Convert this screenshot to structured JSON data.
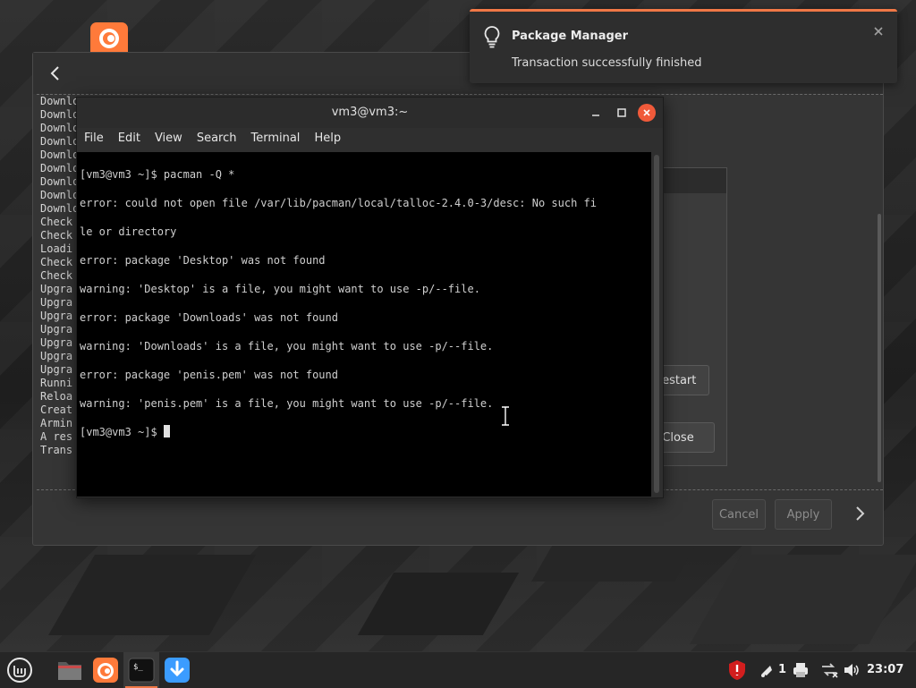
{
  "background_app": {
    "log_lines": [
      "Downlo",
      "Downlo",
      "Downlo",
      "Downlo",
      "Downlo",
      "Downlo",
      "Downlo",
      "Downlo",
      "Downlo",
      "Check",
      "Check",
      "Loadi",
      "Check",
      "Check",
      "Upgra",
      "Upgra",
      "Upgra",
      "Upgra",
      "Upgra",
      "Upgra",
      "Upgra",
      "Runni",
      "Reloa",
      "Creat",
      "Armin",
      "A res",
      "Trans"
    ],
    "restart_label": "Restart",
    "close_label": "Close",
    "cancel_label": "Cancel",
    "apply_label": "Apply"
  },
  "terminal": {
    "title": "vm3@vm3:~",
    "menu": [
      "File",
      "Edit",
      "View",
      "Search",
      "Terminal",
      "Help"
    ],
    "lines": [
      "[vm3@vm3 ~]$ pacman -Q *",
      "error: could not open file /var/lib/pacman/local/talloc-2.4.0-3/desc: No such fi",
      "le or directory",
      "error: package 'Desktop' was not found",
      "warning: 'Desktop' is a file, you might want to use -p/--file.",
      "error: package 'Downloads' was not found",
      "warning: 'Downloads' is a file, you might want to use -p/--file.",
      "error: package 'penis.pem' was not found",
      "warning: 'penis.pem' is a file, you might want to use -p/--file."
    ],
    "prompt": "[vm3@vm3 ~]$ "
  },
  "notification": {
    "title": "Package Manager",
    "body": "Transaction successfully finished"
  },
  "taskbar": {
    "notification_count": "1",
    "clock": "23:07"
  },
  "colors": {
    "accent": "#f07846",
    "terminal_bg": "#000000",
    "shield": "#d21e1e"
  },
  "icons": [
    "mint-menu-icon",
    "folder-icon",
    "firefox-icon",
    "terminal-icon",
    "update-manager-icon",
    "shield-icon",
    "bell-icon",
    "printer-icon",
    "network-icon",
    "volume-icon",
    "lightbulb-icon",
    "close-icon",
    "back-arrow-icon",
    "forward-arrow-icon",
    "minimize-icon",
    "maximize-icon",
    "text-cursor-icon"
  ]
}
